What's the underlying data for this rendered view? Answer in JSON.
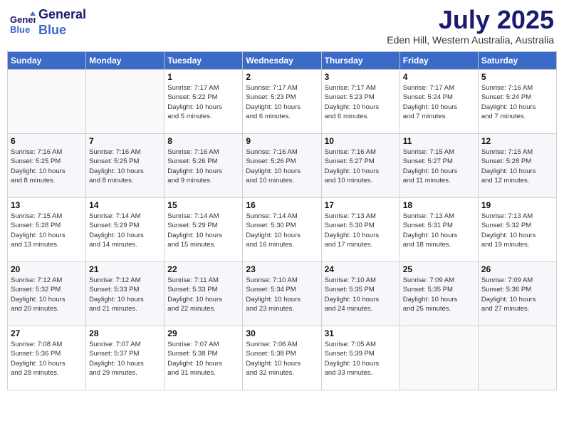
{
  "header": {
    "logo_line1": "General",
    "logo_line2": "Blue",
    "month_year": "July 2025",
    "location": "Eden Hill, Western Australia, Australia"
  },
  "calendar": {
    "days_of_week": [
      "Sunday",
      "Monday",
      "Tuesday",
      "Wednesday",
      "Thursday",
      "Friday",
      "Saturday"
    ],
    "weeks": [
      [
        {
          "day": "",
          "detail": ""
        },
        {
          "day": "",
          "detail": ""
        },
        {
          "day": "1",
          "detail": "Sunrise: 7:17 AM\nSunset: 5:22 PM\nDaylight: 10 hours\nand 5 minutes."
        },
        {
          "day": "2",
          "detail": "Sunrise: 7:17 AM\nSunset: 5:23 PM\nDaylight: 10 hours\nand 6 minutes."
        },
        {
          "day": "3",
          "detail": "Sunrise: 7:17 AM\nSunset: 5:23 PM\nDaylight: 10 hours\nand 6 minutes."
        },
        {
          "day": "4",
          "detail": "Sunrise: 7:17 AM\nSunset: 5:24 PM\nDaylight: 10 hours\nand 7 minutes."
        },
        {
          "day": "5",
          "detail": "Sunrise: 7:16 AM\nSunset: 5:24 PM\nDaylight: 10 hours\nand 7 minutes."
        }
      ],
      [
        {
          "day": "6",
          "detail": "Sunrise: 7:16 AM\nSunset: 5:25 PM\nDaylight: 10 hours\nand 8 minutes."
        },
        {
          "day": "7",
          "detail": "Sunrise: 7:16 AM\nSunset: 5:25 PM\nDaylight: 10 hours\nand 8 minutes."
        },
        {
          "day": "8",
          "detail": "Sunrise: 7:16 AM\nSunset: 5:26 PM\nDaylight: 10 hours\nand 9 minutes."
        },
        {
          "day": "9",
          "detail": "Sunrise: 7:16 AM\nSunset: 5:26 PM\nDaylight: 10 hours\nand 10 minutes."
        },
        {
          "day": "10",
          "detail": "Sunrise: 7:16 AM\nSunset: 5:27 PM\nDaylight: 10 hours\nand 10 minutes."
        },
        {
          "day": "11",
          "detail": "Sunrise: 7:15 AM\nSunset: 5:27 PM\nDaylight: 10 hours\nand 11 minutes."
        },
        {
          "day": "12",
          "detail": "Sunrise: 7:15 AM\nSunset: 5:28 PM\nDaylight: 10 hours\nand 12 minutes."
        }
      ],
      [
        {
          "day": "13",
          "detail": "Sunrise: 7:15 AM\nSunset: 5:28 PM\nDaylight: 10 hours\nand 13 minutes."
        },
        {
          "day": "14",
          "detail": "Sunrise: 7:14 AM\nSunset: 5:29 PM\nDaylight: 10 hours\nand 14 minutes."
        },
        {
          "day": "15",
          "detail": "Sunrise: 7:14 AM\nSunset: 5:29 PM\nDaylight: 10 hours\nand 15 minutes."
        },
        {
          "day": "16",
          "detail": "Sunrise: 7:14 AM\nSunset: 5:30 PM\nDaylight: 10 hours\nand 16 minutes."
        },
        {
          "day": "17",
          "detail": "Sunrise: 7:13 AM\nSunset: 5:30 PM\nDaylight: 10 hours\nand 17 minutes."
        },
        {
          "day": "18",
          "detail": "Sunrise: 7:13 AM\nSunset: 5:31 PM\nDaylight: 10 hours\nand 18 minutes."
        },
        {
          "day": "19",
          "detail": "Sunrise: 7:13 AM\nSunset: 5:32 PM\nDaylight: 10 hours\nand 19 minutes."
        }
      ],
      [
        {
          "day": "20",
          "detail": "Sunrise: 7:12 AM\nSunset: 5:32 PM\nDaylight: 10 hours\nand 20 minutes."
        },
        {
          "day": "21",
          "detail": "Sunrise: 7:12 AM\nSunset: 5:33 PM\nDaylight: 10 hours\nand 21 minutes."
        },
        {
          "day": "22",
          "detail": "Sunrise: 7:11 AM\nSunset: 5:33 PM\nDaylight: 10 hours\nand 22 minutes."
        },
        {
          "day": "23",
          "detail": "Sunrise: 7:10 AM\nSunset: 5:34 PM\nDaylight: 10 hours\nand 23 minutes."
        },
        {
          "day": "24",
          "detail": "Sunrise: 7:10 AM\nSunset: 5:35 PM\nDaylight: 10 hours\nand 24 minutes."
        },
        {
          "day": "25",
          "detail": "Sunrise: 7:09 AM\nSunset: 5:35 PM\nDaylight: 10 hours\nand 25 minutes."
        },
        {
          "day": "26",
          "detail": "Sunrise: 7:09 AM\nSunset: 5:36 PM\nDaylight: 10 hours\nand 27 minutes."
        }
      ],
      [
        {
          "day": "27",
          "detail": "Sunrise: 7:08 AM\nSunset: 5:36 PM\nDaylight: 10 hours\nand 28 minutes."
        },
        {
          "day": "28",
          "detail": "Sunrise: 7:07 AM\nSunset: 5:37 PM\nDaylight: 10 hours\nand 29 minutes."
        },
        {
          "day": "29",
          "detail": "Sunrise: 7:07 AM\nSunset: 5:38 PM\nDaylight: 10 hours\nand 31 minutes."
        },
        {
          "day": "30",
          "detail": "Sunrise: 7:06 AM\nSunset: 5:38 PM\nDaylight: 10 hours\nand 32 minutes."
        },
        {
          "day": "31",
          "detail": "Sunrise: 7:05 AM\nSunset: 5:39 PM\nDaylight: 10 hours\nand 33 minutes."
        },
        {
          "day": "",
          "detail": ""
        },
        {
          "day": "",
          "detail": ""
        }
      ]
    ]
  }
}
